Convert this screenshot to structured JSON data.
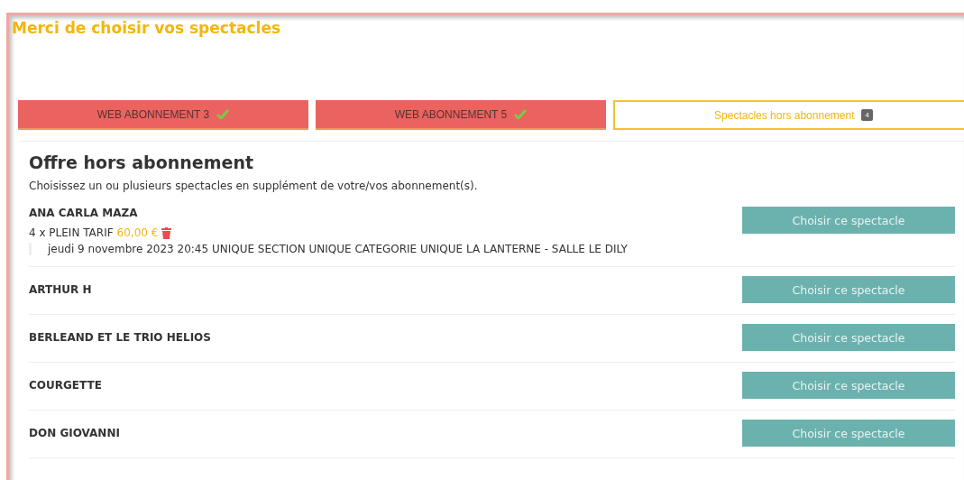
{
  "page_title": "Merci de choisir vos spectacles",
  "tabs": [
    {
      "label": "WEB ABONNEMENT 3",
      "completed": true,
      "selected": false
    },
    {
      "label": "WEB ABONNEMENT 5",
      "completed": true,
      "selected": false
    },
    {
      "label": "Spectacles hors abonnement",
      "completed": false,
      "selected": true,
      "badge": "4"
    }
  ],
  "section": {
    "title": "Offre hors abonnement",
    "description": "Choisissez un ou plusieurs spectacles en supplément de votre/vos abonnement(s)."
  },
  "shows": [
    {
      "name": "ANA CARLA MAZA",
      "button": "Choisir ce spectacle",
      "booking": {
        "quantity": "4 x PLEIN TARIF",
        "price": "60,00 €",
        "detail": "jeudi 9 novembre 2023 20:45 UNIQUE SECTION UNIQUE CATEGORIE UNIQUE LA LANTERNE - SALLE LE DILY"
      }
    },
    {
      "name": "ARTHUR H",
      "button": "Choisir ce spectacle"
    },
    {
      "name": "BERLEAND ET LE TRIO HELIOS",
      "button": "Choisir ce spectacle"
    },
    {
      "name": "COURGETTE",
      "button": "Choisir ce spectacle"
    },
    {
      "name": "DON GIOVANNI",
      "button": "Choisir ce spectacle"
    }
  ]
}
